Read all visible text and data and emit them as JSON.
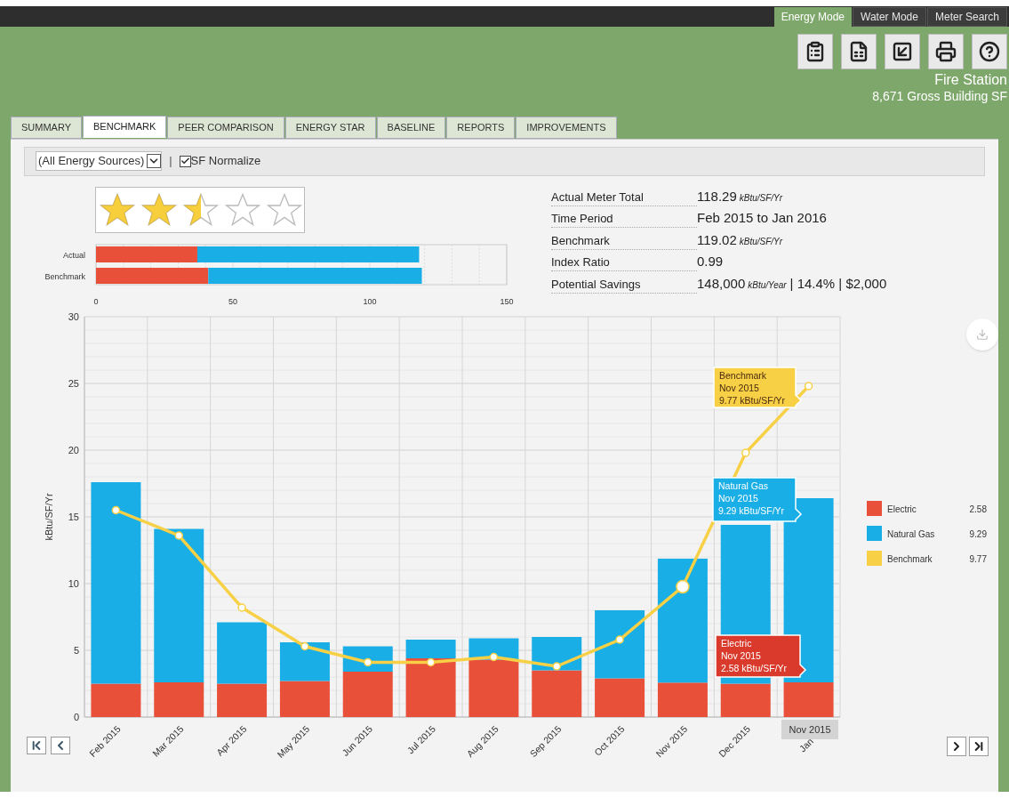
{
  "top_tabs": [
    {
      "label": "Energy Mode",
      "selected": true
    },
    {
      "label": "Water Mode",
      "selected": false
    },
    {
      "label": "Meter Search",
      "selected": false
    }
  ],
  "building": {
    "name": "Fire Station",
    "area": "8,671 Gross Building SF"
  },
  "tabs": [
    {
      "label": "SUMMARY",
      "selected": false
    },
    {
      "label": "BENCHMARK",
      "selected": true
    },
    {
      "label": "PEER COMPARISON",
      "selected": false
    },
    {
      "label": "ENERGY STAR",
      "selected": false
    },
    {
      "label": "BASELINE",
      "selected": false
    },
    {
      "label": "REPORTS",
      "selected": false
    },
    {
      "label": "IMPROVEMENTS",
      "selected": false
    }
  ],
  "toolbar": {
    "source_select": "(All Energy Sources)",
    "separator": "|",
    "sf_normalize": {
      "label": "SF Normalize",
      "checked": true
    }
  },
  "rating": {
    "stars": 2.5
  },
  "comparison": {
    "chart_data": {
      "type": "bar",
      "orientation": "horizontal",
      "stacked": true,
      "categories": [
        "Actual",
        "Benchmark"
      ],
      "xlim": [
        0,
        150
      ],
      "xticks": [
        0,
        50,
        100,
        150
      ],
      "series": [
        {
          "color": "#e8503a",
          "values": [
            37,
            41
          ]
        },
        {
          "color": "#1aaee6",
          "values": [
            81,
            78
          ]
        }
      ]
    }
  },
  "summary": [
    {
      "label": "Actual Meter Total",
      "value": "118.29",
      "unit": "kBtu/SF/Yr"
    },
    {
      "label": "Time Period",
      "value": "Feb 2015 to Jan 2016"
    },
    {
      "label": "Benchmark",
      "value": "119.02",
      "unit": "kBtu/SF/Yr"
    },
    {
      "label": "Index Ratio",
      "value": "0.99"
    },
    {
      "label": "Potential Savings",
      "value": "148,000",
      "unit": "kBtu/Year",
      "suffix": "| 14.4% | $2,000"
    }
  ],
  "main_chart": {
    "chart_data": {
      "type": "bar",
      "stacked": true,
      "grid": true,
      "legend": true,
      "ylabel": "kBtu/SF/Yr",
      "ylim": [
        0,
        30
      ],
      "yticks": [
        0,
        5,
        10,
        15,
        20,
        25,
        30
      ],
      "categories": [
        "Feb 2015",
        "Mar 2015",
        "Apr 2015",
        "May 2015",
        "Jun 2015",
        "Jul 2015",
        "Aug 2015",
        "Sep 2015",
        "Oct 2015",
        "Nov 2015",
        "Dec 2015",
        "Jan"
      ],
      "series": [
        {
          "name": "Electric",
          "color": "#e8503a",
          "values": [
            2.5,
            2.6,
            2.5,
            2.7,
            3.4,
            4.4,
            4.3,
            3.5,
            2.9,
            2.58,
            2.5,
            2.6
          ]
        },
        {
          "name": "Natural Gas",
          "color": "#1aaee6",
          "values": [
            15.1,
            11.5,
            4.6,
            2.9,
            1.9,
            1.4,
            1.6,
            2.5,
            5.1,
            9.29,
            11.9,
            13.8
          ]
        },
        {
          "name": "Benchmark",
          "type": "line",
          "marker": "circle",
          "color": "#f7d046",
          "values": [
            15.5,
            13.6,
            8.2,
            5.3,
            4.1,
            4.1,
            4.5,
            3.8,
            5.8,
            9.77,
            19.8,
            24.8
          ]
        }
      ]
    },
    "crosshair_label": "Nov 2015",
    "tooltips": [
      {
        "kind": "dark",
        "color": "#f7d046",
        "lines": [
          "Benchmark",
          "Nov 2015",
          "9.77 kBtu/SF/Yr"
        ]
      },
      {
        "kind": "light",
        "color": "#1aaee6",
        "lines": [
          "Natural Gas",
          "Nov 2015",
          "9.29 kBtu/SF/Yr"
        ]
      },
      {
        "kind": "light",
        "color": "#d93a2b",
        "lines": [
          "Electric",
          "Nov 2015",
          "2.58 kBtu/SF/Yr"
        ]
      }
    ],
    "legend_values": [
      "2.58",
      "9.29",
      "9.77"
    ]
  }
}
